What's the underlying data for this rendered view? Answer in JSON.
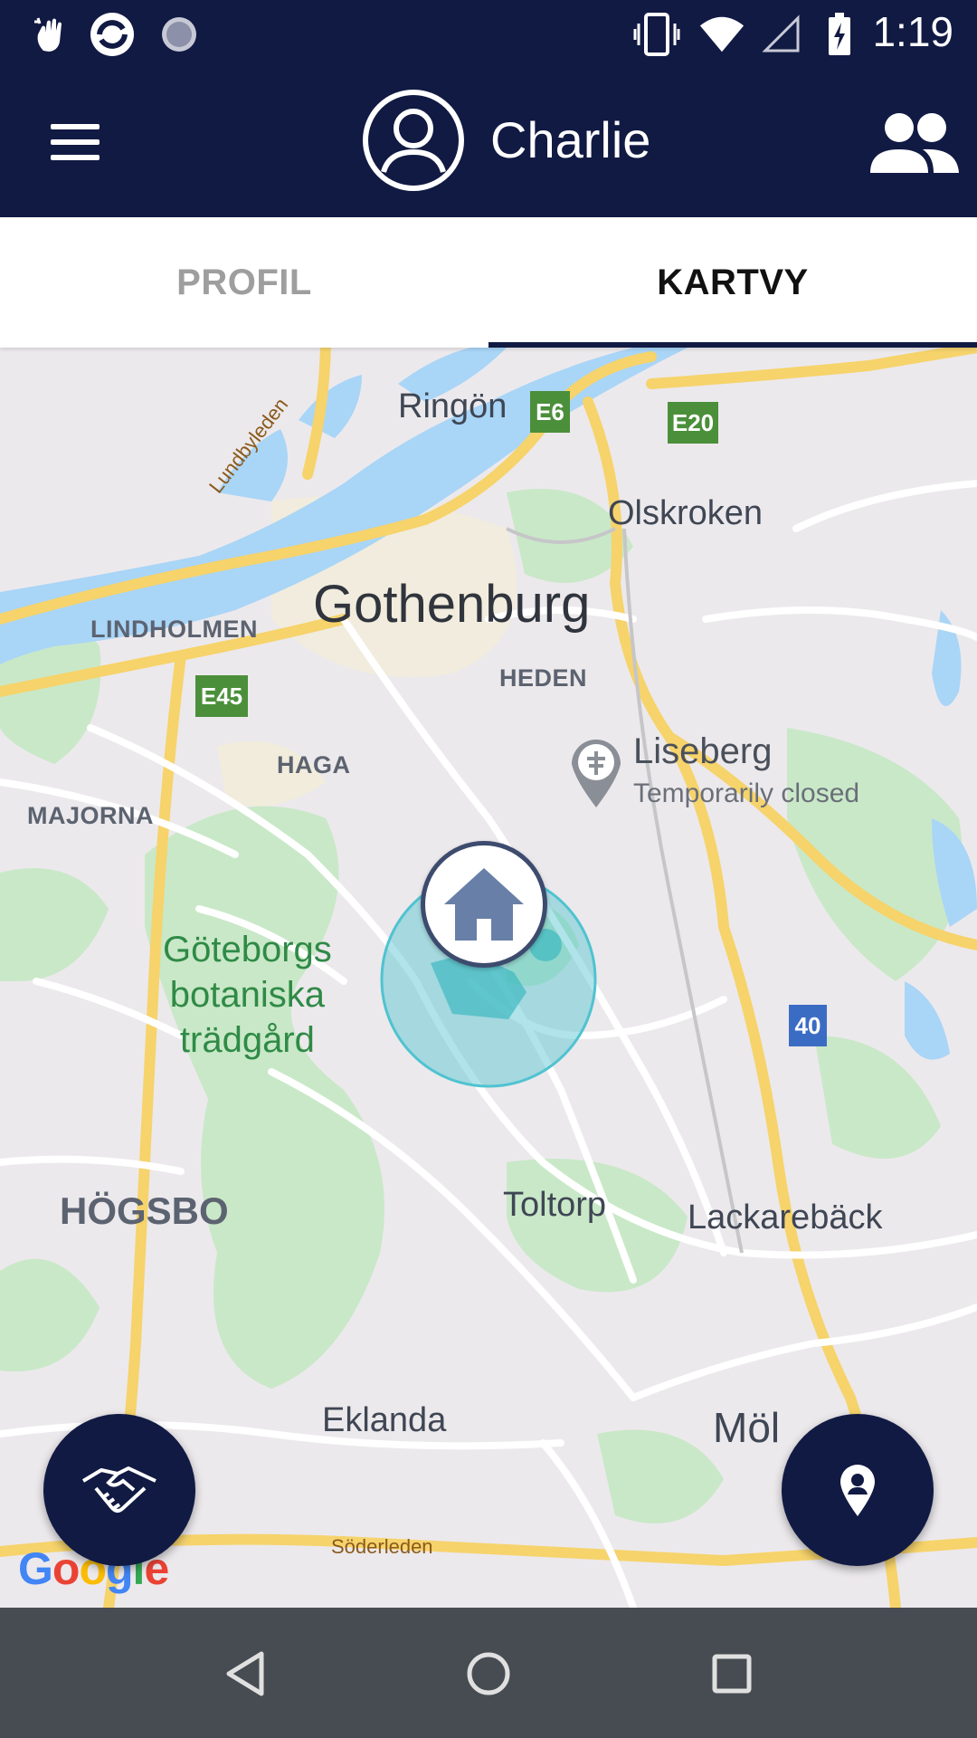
{
  "status_bar": {
    "time": "1:19",
    "left_icons": [
      "hand-sparkle-icon",
      "sync-app-icon",
      "loading-circle-icon"
    ],
    "right_icons": [
      "vibrate-icon",
      "wifi-icon",
      "cell-signal-icon",
      "battery-charging-icon"
    ]
  },
  "app_bar": {
    "user_name": "Charlie",
    "menu_icon": "menu-icon",
    "avatar_icon": "account-circle-icon",
    "people_icon": "people-icon"
  },
  "tabs": [
    {
      "label": "PROFIL",
      "selected": false
    },
    {
      "label": "KARTVY",
      "selected": true
    }
  ],
  "map": {
    "labels": {
      "ringon": "Ringön",
      "olskroken": "Olskroken",
      "lundbyleden": "Lundbyleden",
      "lindholmen": "LINDHOLMEN",
      "gothenburg": "Gothenburg",
      "heden": "HEDEN",
      "haga": "HAGA",
      "majorna": "MAJORNA",
      "liseberg": "Liseberg",
      "liseberg_status": "Temporarily closed",
      "park_line1": "Göteborgs",
      "park_line2": "botaniska",
      "park_line3": "trädgård",
      "hogsbo": "HÖGSBO",
      "toltorp": "Toltorp",
      "lackareback": "Lackarebäck",
      "eklanda": "Eklanda",
      "molndal": "Möl",
      "soderleden": "Söderleden",
      "google": "Google"
    },
    "road_shields": {
      "e6": "E6",
      "e20": "E20",
      "e45": "E45",
      "r40": "40"
    },
    "colors": {
      "water": "#a9d5f7",
      "park": "#c9e8c8",
      "road_major": "#f6d36b",
      "geofence": "#4fc3d0"
    }
  },
  "fabs": {
    "left_icon": "handshake-icon",
    "right_icon": "location-pin-icon"
  },
  "nav_bar": {
    "back_icon": "back-icon",
    "home_icon": "home-circle-icon",
    "recents_icon": "recents-icon"
  }
}
